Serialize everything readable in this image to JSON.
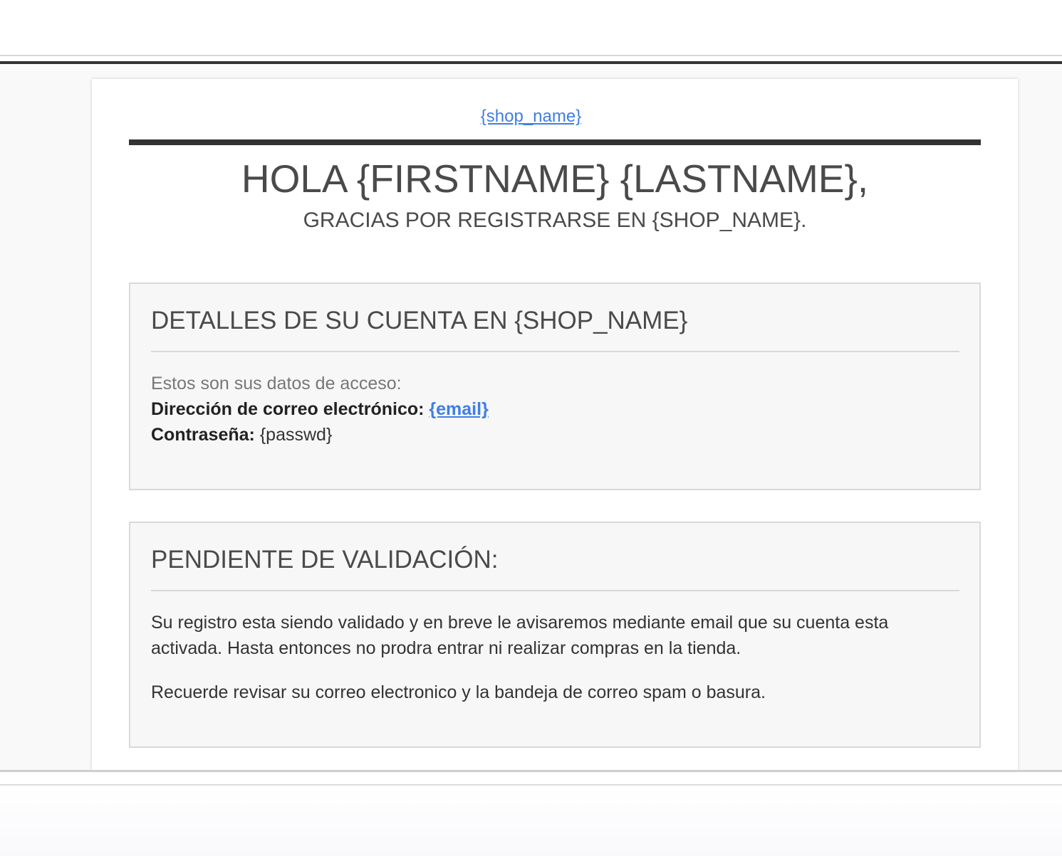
{
  "header": {
    "shop_link": "{shop_name}"
  },
  "greeting": {
    "title": "HOLA {FIRSTNAME} {LASTNAME},",
    "subtitle": "GRACIAS POR REGISTRARSE EN {SHOP_NAME}."
  },
  "account_panel": {
    "title": "DETALLES DE SU CUENTA EN {SHOP_NAME}",
    "intro": "Estos son sus datos de acceso:",
    "email_label": "Dirección de correo electrónico:",
    "email_value": "{email}",
    "password_label": "Contraseña:",
    "password_value": "{passwd}"
  },
  "pending_panel": {
    "title": "PENDIENTE DE VALIDACIÓN:",
    "paragraph_1": "Su registro esta siendo validado y en breve le avisaremos mediante email que su cuenta esta activada. Hasta entonces no prodra entrar ni realizar compras en la tienda.",
    "paragraph_2": "Recuerde revisar su correo electronico y la bandeja de correo spam o basura."
  },
  "colors": {
    "link": "#3f7ee6",
    "heading": "#4a4a4a",
    "rule": "#333333",
    "panel_bg": "#f7f7f7"
  }
}
